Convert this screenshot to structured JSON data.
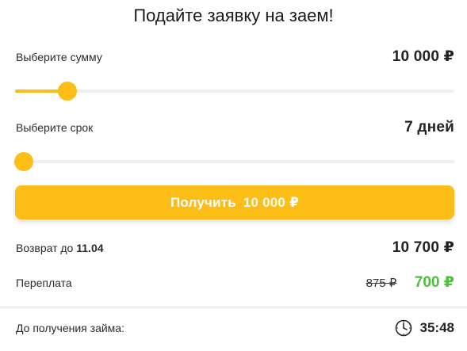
{
  "title": "Подайте заявку на заем!",
  "amount": {
    "label": "Выберите сумму",
    "value": "10 000 ₽",
    "slider_fraction": 0.12
  },
  "term": {
    "label": "Выберите срок",
    "value": "7 дней",
    "slider_fraction": 0.0
  },
  "cta": {
    "label": "Получить",
    "amount": "10 000 ₽"
  },
  "repayment": {
    "label": "Возврат до",
    "date": "11.04",
    "value": "10 700 ₽"
  },
  "overpayment": {
    "label": "Переплата",
    "old_value": "875 ₽",
    "new_value": "700 ₽"
  },
  "countdown": {
    "label": "До получения займа:",
    "icon": "clock-icon",
    "time": "35:48"
  },
  "colors": {
    "accent": "#fbbd16",
    "discount": "#4cc13c"
  }
}
